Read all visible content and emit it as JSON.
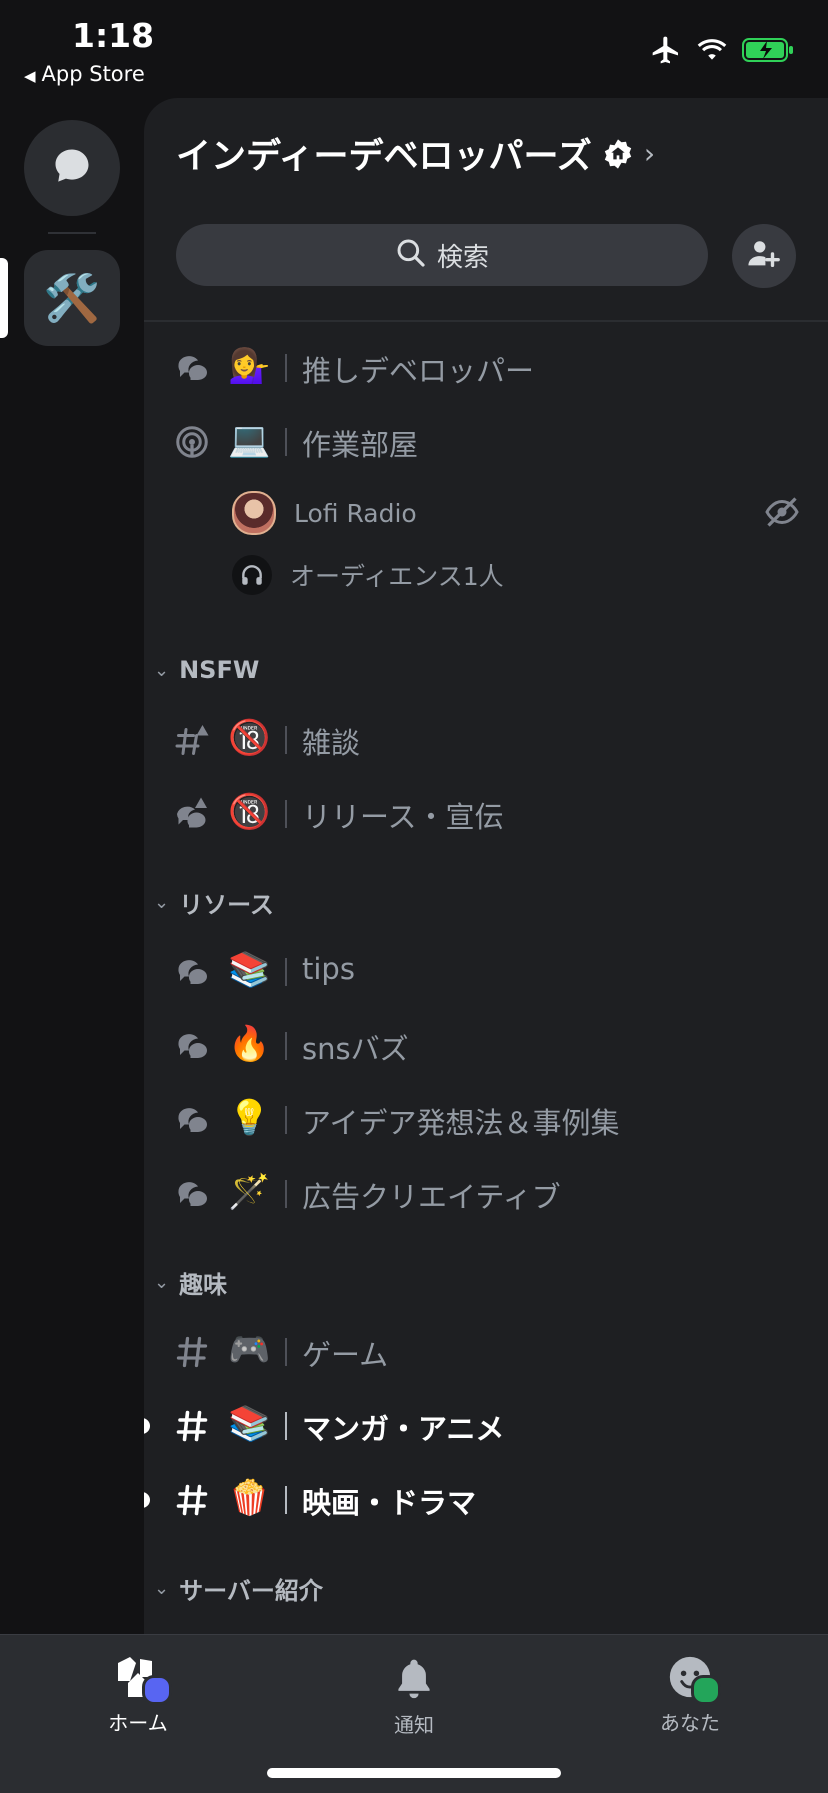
{
  "status_bar": {
    "time": "1:18",
    "back_label": "App Store",
    "icons": [
      "airplane-icon",
      "wifi-icon",
      "battery-charging-icon"
    ]
  },
  "rail": {
    "items": [
      {
        "name": "direct-messages",
        "icon": "chat-bubble-icon"
      },
      {
        "name": "server",
        "emoji": "🛠️",
        "selected": true
      }
    ]
  },
  "server": {
    "name": "インディーデベロッパーズ",
    "badge_icon": "community-home-badge-icon",
    "search_placeholder": "検索"
  },
  "channels": {
    "top": [
      {
        "type": "forum",
        "emoji": "💁‍♀️",
        "name": "推しデベロッパー"
      },
      {
        "type": "stage",
        "emoji": "💻",
        "name": "作業部屋"
      }
    ],
    "voice_users": [
      {
        "name": "Lofi Radio",
        "right_icon": "stream-hidden-icon"
      },
      {
        "name": "オーディエンス1人",
        "icon": "headphones-icon"
      }
    ],
    "categories": [
      {
        "name": "NSFW",
        "items": [
          {
            "type": "text-nsfw",
            "emoji": "🔞",
            "name": "雑談"
          },
          {
            "type": "forum-nsfw",
            "emoji": "🔞",
            "name": "リリース・宣伝"
          }
        ]
      },
      {
        "name": "リソース",
        "items": [
          {
            "type": "forum",
            "emoji": "📚",
            "name": "tips"
          },
          {
            "type": "forum",
            "emoji": "🔥",
            "name": "snsバズ"
          },
          {
            "type": "forum",
            "emoji": "💡",
            "name": "アイデア発想法＆事例集"
          },
          {
            "type": "forum",
            "emoji": "🪄",
            "name": "広告クリエイティブ"
          }
        ]
      },
      {
        "name": "趣味",
        "items": [
          {
            "type": "text",
            "emoji": "🎮",
            "name": "ゲーム"
          },
          {
            "type": "text",
            "emoji": "📚",
            "name": "マンガ・アニメ",
            "unread": true
          },
          {
            "type": "text",
            "emoji": "🍿",
            "name": "映画・ドラマ",
            "unread": true
          }
        ]
      },
      {
        "name": "サーバー紹介",
        "items": []
      }
    ]
  },
  "tabbar": {
    "home": "ホーム",
    "notifications": "通知",
    "you": "あなた"
  },
  "colors": {
    "background": "#121214",
    "panel": "#1e1f22",
    "accent": "#5865f2",
    "online": "#23a55a"
  }
}
